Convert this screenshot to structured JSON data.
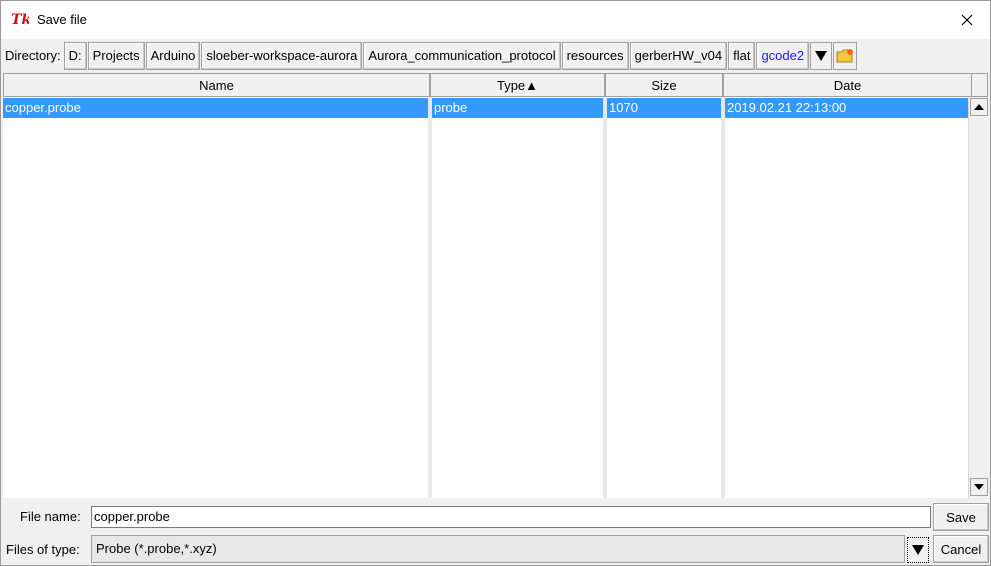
{
  "window": {
    "title": "Save file"
  },
  "directory": {
    "label": "Directory:",
    "path": [
      "D:",
      "Projects",
      "Arduino",
      "sloeber-workspace-aurora",
      "Aurora_communication_protocol",
      "resources",
      "gerberHW_v04",
      "flat",
      "gcode2"
    ],
    "current_color": "#1a1aff"
  },
  "columns": {
    "name": "Name",
    "type": "Type▲",
    "size": "Size",
    "date": "Date"
  },
  "files": [
    {
      "name": "copper.probe",
      "type": "probe",
      "size": "1070",
      "date": "2019.02.21 22:13:00",
      "selected": true
    }
  ],
  "selection_color": "#3399ff",
  "bottom": {
    "filename_label": "File name:",
    "filename_value": "copper.probe",
    "filetype_label": "Files of type:",
    "filetype_value": "Probe (*.probe,*.xyz)",
    "save_label": "Save",
    "cancel_label": "Cancel"
  },
  "icons": {
    "app": "tk-logo-icon",
    "close": "close-icon",
    "dropdown": "triangle-down-icon",
    "new_folder": "new-folder-icon",
    "scroll_up": "scroll-up-icon",
    "scroll_down": "scroll-down-icon"
  }
}
